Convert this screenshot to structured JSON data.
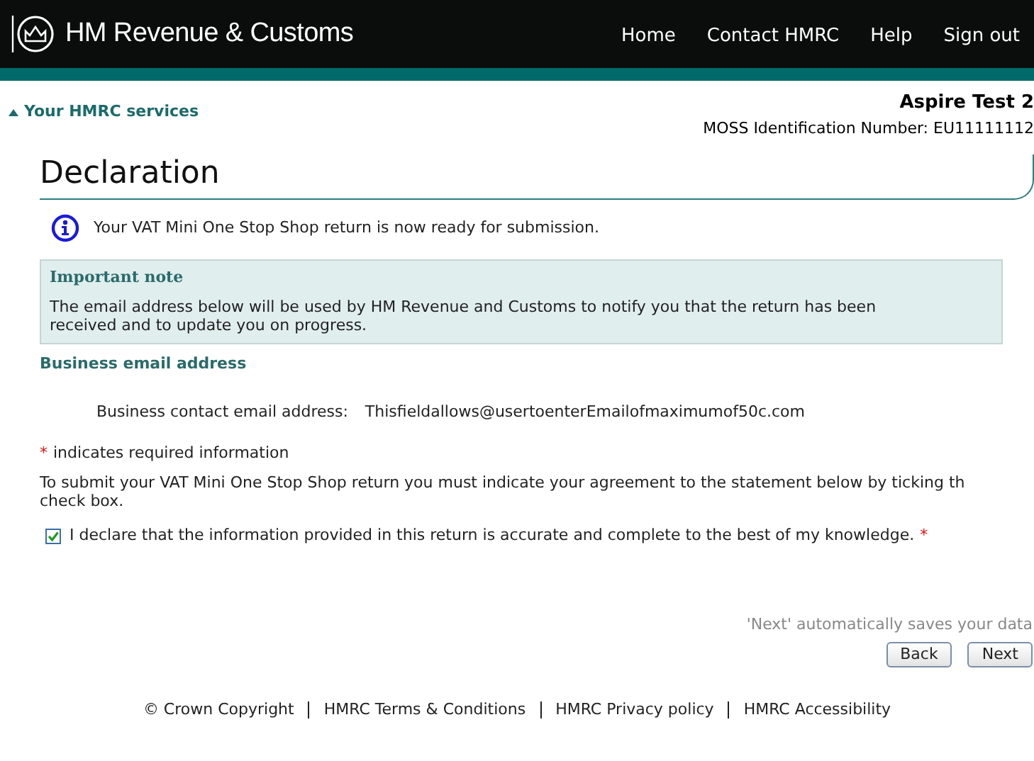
{
  "header": {
    "brand": "HM Revenue & Customs",
    "nav": [
      "Home",
      "Contact HMRC",
      "Help",
      "Sign out"
    ]
  },
  "services_link": "Your HMRC services",
  "account": {
    "name": "Aspire Test 2",
    "id_line": "MOSS Identification Number: EU11111112"
  },
  "title": "Declaration",
  "info_message": "Your VAT Mini One Stop Shop return is now ready for submission.",
  "note": {
    "heading": "Important note",
    "text": "The email address below will be used by HM Revenue and Customs to notify you that the return has been received and to update you on progress."
  },
  "email_section": {
    "heading": "Business email address",
    "label": "Business contact email address:",
    "value": "Thisfieldallows@usertoenterEmailofmaximumof50c.com"
  },
  "required_marker": "*",
  "required_text": "indicates required information",
  "instruction_lines": [
    "To submit your VAT Mini One Stop Shop return you must indicate your agreement to the statement below by ticking th",
    "check box."
  ],
  "declaration": {
    "label": "I declare that the information provided in this return is accurate and complete to the best of my knowledge.",
    "checked": true,
    "required_marker": "*"
  },
  "save_note": "'Next' automatically saves your data",
  "buttons": [
    "Back",
    "Next"
  ],
  "footer": [
    "© Crown Copyright",
    "HMRC Terms & Conditions",
    "HMRC Privacy policy",
    "HMRC Accessibility"
  ]
}
